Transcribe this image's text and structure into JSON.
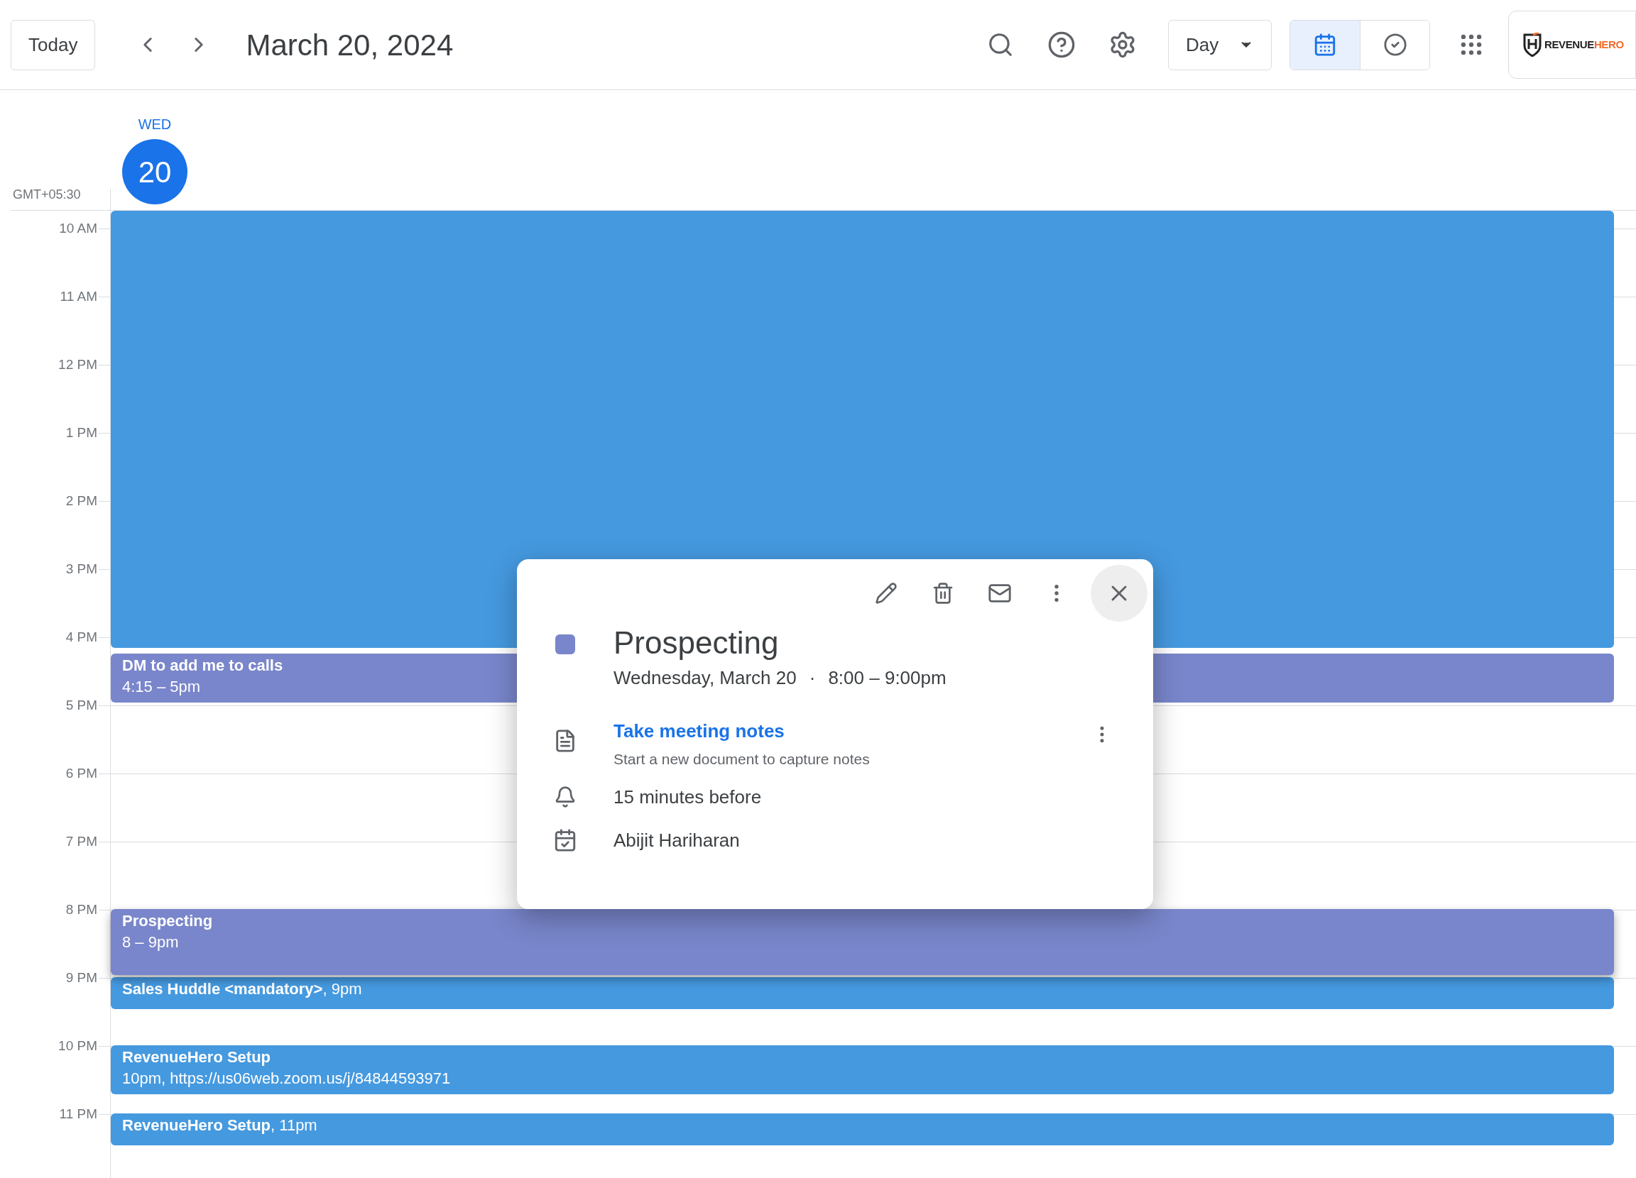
{
  "toolbar": {
    "today_button": "Today",
    "date_title": "March 20, 2024",
    "view_select": "Day",
    "view_toggle": [
      {
        "kind": "calendar",
        "selected": true
      },
      {
        "kind": "tasks",
        "selected": false
      }
    ],
    "logo": {
      "dark": "REVENUE",
      "accent": "HERO"
    }
  },
  "day_header": {
    "weekday": "WED",
    "day": "20",
    "is_today": true
  },
  "timezone": "GMT+05:30",
  "hours": [
    "10 AM",
    "11 AM",
    "12 PM",
    "1 PM",
    "2 PM",
    "3 PM",
    "4 PM",
    "5 PM",
    "6 PM",
    "7 PM",
    "8 PM",
    "9 PM",
    "10 PM",
    "11 PM"
  ],
  "events": [
    {
      "kind": "block",
      "color": "#4599df",
      "selected": false
    },
    {
      "kind": "stacked",
      "title": "DM to add me to calls",
      "detail": "4:15 – 5pm",
      "color": "#7986cb",
      "selected": false
    },
    {
      "kind": "stacked",
      "title": "Prospecting",
      "detail": "8 – 9pm",
      "color": "#7986cb",
      "selected": true
    },
    {
      "kind": "inline",
      "text": "**Sales Huddle <mandatory>**, 9pm",
      "color": "#4599df",
      "selected": false
    },
    {
      "kind": "stacked",
      "title": "RevenueHero Setup",
      "detail": "10pm, https://us06web.zoom.us/j/84844593971",
      "color": "#4599df",
      "selected": false
    },
    {
      "kind": "inline",
      "text": "**RevenueHero Setup**, 11pm",
      "color": "#4599df",
      "selected": false
    }
  ],
  "popup": {
    "color": "#7986cb",
    "title": "Prospecting",
    "date": "Wednesday, March 20",
    "separator": "·",
    "time": "8:00 – 9:00pm",
    "notes": {
      "link": "Take meeting notes",
      "description": "Start a new document to capture notes"
    },
    "reminder": "15 minutes before",
    "calendar": "Abijit Hariharan"
  }
}
